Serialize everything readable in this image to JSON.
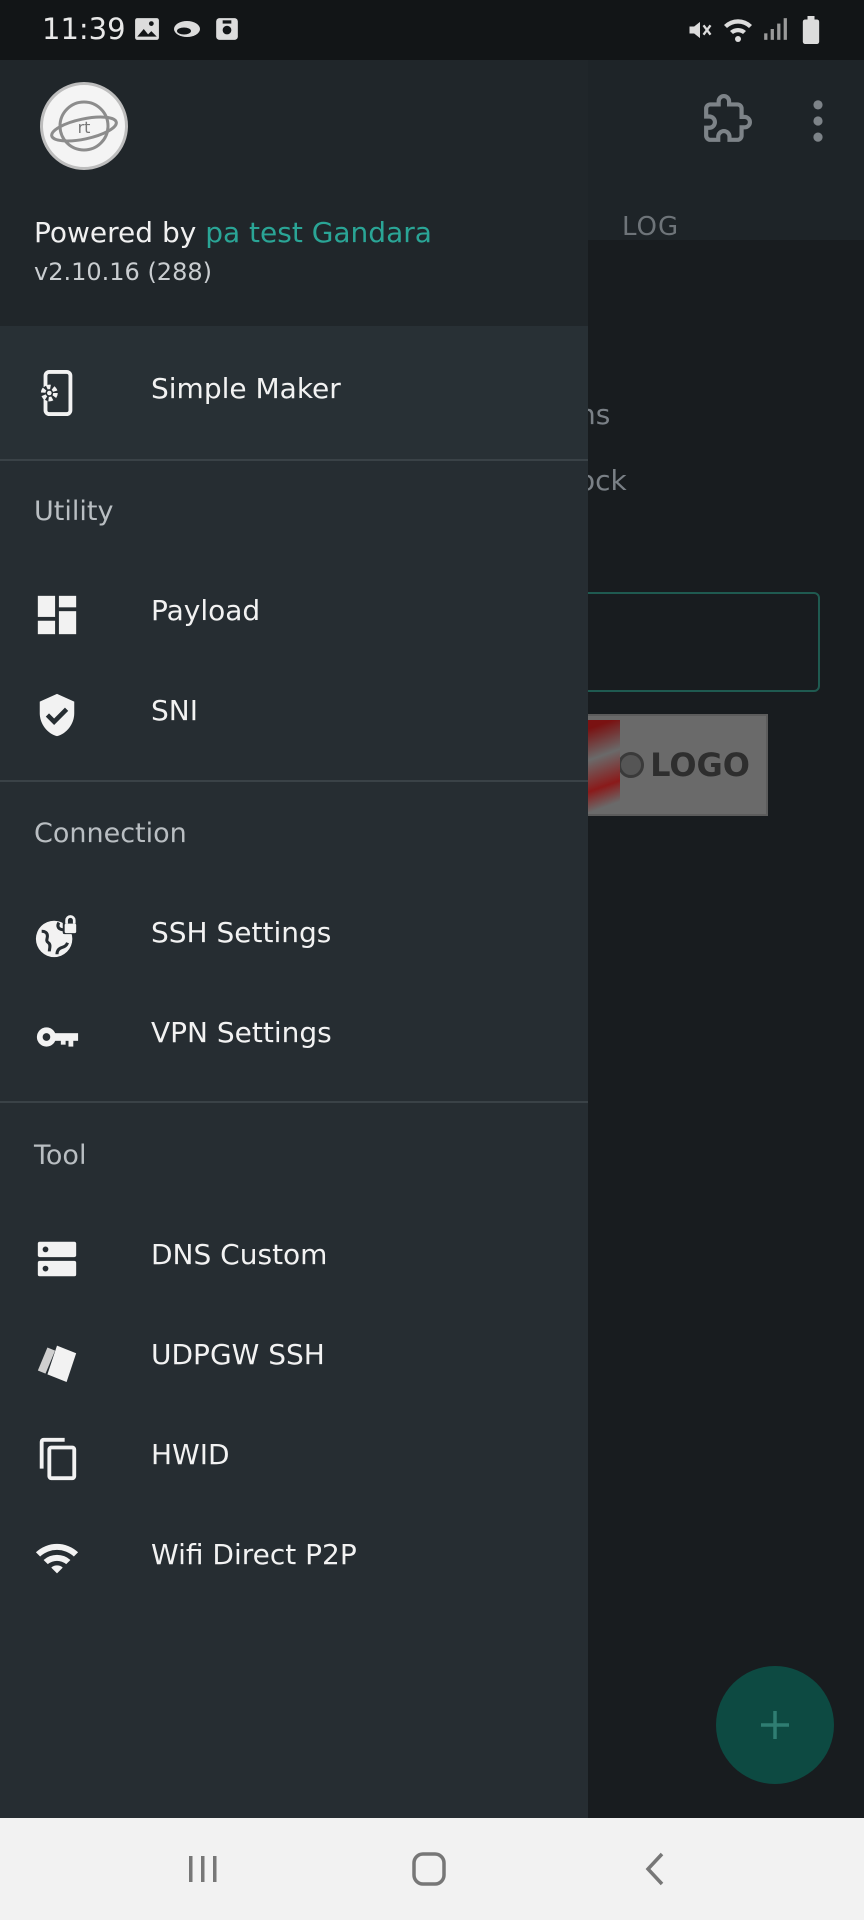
{
  "status_bar": {
    "time": "11:39"
  },
  "background_app": {
    "tab_log": "LOG",
    "fragment_1": "ns",
    "fragment_2": "ock",
    "logo_text": "LOGO",
    "fab_symbol": "+"
  },
  "drawer": {
    "header": {
      "powered_prefix": "Powered by ",
      "powered_brand": "pa test Gandara",
      "version": "v2.10.16 (288)",
      "avatar_text": "rt",
      "brand_color": "#2aa596"
    },
    "top_item": {
      "label": "Simple Maker",
      "icon": "phone-settings-icon"
    },
    "sections": [
      {
        "title": "Utility",
        "items": [
          {
            "label": "Payload",
            "icon": "dashboard-icon"
          },
          {
            "label": "SNI",
            "icon": "shield-check-icon"
          }
        ]
      },
      {
        "title": "Connection",
        "items": [
          {
            "label": "SSH Settings",
            "icon": "globe-lock-icon"
          },
          {
            "label": "VPN Settings",
            "icon": "key-icon"
          }
        ]
      },
      {
        "title": "Tool",
        "items": [
          {
            "label": "DNS Custom",
            "icon": "dns-icon"
          },
          {
            "label": "UDPGW SSH",
            "icon": "cards-icon"
          },
          {
            "label": "HWID",
            "icon": "copy-icon"
          },
          {
            "label": "Wifi Direct P2P",
            "icon": "wifi-icon"
          }
        ]
      }
    ]
  },
  "colors": {
    "drawer_bg": "#262d32",
    "accent": "#2aa596",
    "fab": "#0d4a42"
  }
}
